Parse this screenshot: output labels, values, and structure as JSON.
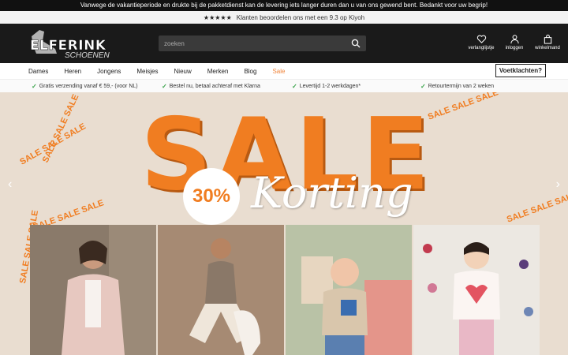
{
  "notice": "Vanwege de vakantieperiode en drukte bij de pakketdienst kan de levering iets langer duren dan u van ons gewend bent. Bedankt voor uw begrip!",
  "rating": {
    "stars": "★★★★★",
    "text": "Klanten beoordelen ons met een 9.3 op Kiyoh"
  },
  "logo": {
    "main": "ELFERINK",
    "sub": "SCHOENEN"
  },
  "search": {
    "placeholder": "zoeken"
  },
  "actions": [
    {
      "label": "verlanglijstje",
      "icon": "heart-icon"
    },
    {
      "label": "inloggen",
      "icon": "user-icon"
    },
    {
      "label": "winkelmand",
      "icon": "bag-icon"
    }
  ],
  "nav": [
    "Dames",
    "Heren",
    "Jongens",
    "Meisjes",
    "Nieuw",
    "Merken",
    "Blog",
    "Sale"
  ],
  "complaints": "Voetklachten?",
  "usp": [
    "Gratis verzending vanaf € 59,- (voor NL)",
    "Bestel nu, betaal achteraf met Klarna",
    "Levertijd 1-2 werkdagen*",
    "Retourtermijn van 2 weken"
  ],
  "banner": {
    "headline": "SALE",
    "discount": "30%",
    "script": "Korting",
    "ring": "SALE SALE SALE"
  },
  "colors": {
    "accent": "#f07d21",
    "header": "#1a1a1a",
    "check": "#3aa34a"
  }
}
